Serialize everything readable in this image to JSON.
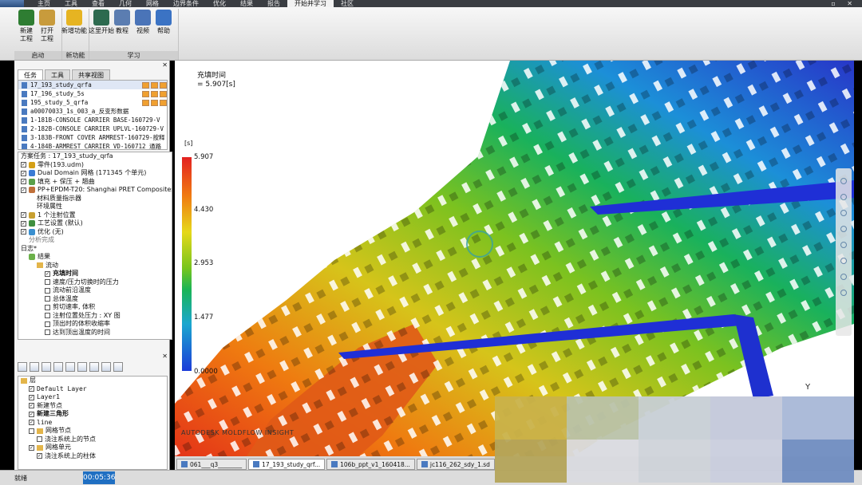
{
  "menubar": {
    "tabs": [
      "主页",
      "工具",
      "查看",
      "几何",
      "网格",
      "边界条件",
      "优化",
      "结果",
      "报告",
      "开始并学习",
      "社区"
    ],
    "active_index": 9
  },
  "ribbon": {
    "groups": [
      {
        "name": "启动",
        "buttons": [
          {
            "label": "新建\n工程",
            "icon": "new-project-icon",
            "color": "#2e7d32"
          },
          {
            "label": "打开\n工程",
            "icon": "open-folder-icon",
            "color": "#c89b3c"
          }
        ]
      },
      {
        "name": "新功能",
        "buttons": [
          {
            "label": "新增功能",
            "icon": "lightbulb-icon",
            "color": "#e6b422"
          }
        ]
      },
      {
        "name": "学习",
        "buttons": [
          {
            "label": "这里开始",
            "icon": "start-here-icon",
            "color": "#2d6a4f"
          },
          {
            "label": "教程",
            "icon": "tutorial-icon",
            "color": "#5b7db1"
          },
          {
            "label": "视频",
            "icon": "video-icon",
            "color": "#4a74b8"
          },
          {
            "label": "帮助",
            "icon": "help-icon",
            "color": "#3b73c4"
          }
        ]
      }
    ]
  },
  "left_panel": {
    "tabs": [
      "任务",
      "工具",
      "共享视图"
    ],
    "study_list": [
      {
        "label": "17_193_study_qrfa",
        "selected": true
      },
      {
        "label": "17_196_study_5s"
      },
      {
        "label": "195_study_5_qrfa"
      },
      {
        "label": "a00070033_1s_003_a_反变形数据"
      },
      {
        "label": "1-181B-CONSOLE CARRIER  BASE-160729-V"
      },
      {
        "label": "2-182B-CONSOLE CARRIER UPLVL-160729-V"
      },
      {
        "label": "3-183B-FRONT COVER ARMREST-160729-按释"
      },
      {
        "label": "4-184B-ARMREST CARRIER VD-160712 通路"
      }
    ],
    "study_tree": [
      {
        "label": "方案任务 : 17_193_study_qrfa",
        "indent": 0,
        "check": ""
      },
      {
        "label": "零件(193.udm)",
        "indent": 0,
        "check": "✓",
        "icon": "#d4a017"
      },
      {
        "label": "Dual Domain 网格 (171345 个单元)",
        "indent": 0,
        "check": "✓",
        "icon": "#3a7bd5"
      },
      {
        "label": "填充 + 保压 + 翘曲",
        "indent": 0,
        "check": "✓",
        "icon": "#5aa04a"
      },
      {
        "label": "PP+EPDM-T20: Shanghai PRET Composites",
        "indent": 0,
        "check": "✓",
        "icon": "#c0703a"
      },
      {
        "label": "材料质量指示器",
        "indent": 2,
        "check": ""
      },
      {
        "label": "环境属性",
        "indent": 2,
        "check": ""
      },
      {
        "label": "1 个注射位置",
        "indent": 0,
        "check": "✓",
        "icon": "#c8a030"
      },
      {
        "label": "工艺设置 (默认)",
        "indent": 0,
        "check": "✓",
        "icon": "#3f8f3f"
      },
      {
        "label": "优化 (无)",
        "indent": 0,
        "check": "✓",
        "icon": "#3a8fcf"
      },
      {
        "label": "分析完成",
        "indent": 1,
        "check": "",
        "dim": true
      },
      {
        "label": "日志*",
        "indent": 0,
        "check": ""
      },
      {
        "label": "结果",
        "indent": 1,
        "check": "",
        "icon": "#6bb04a"
      },
      {
        "label": "流动",
        "indent": 2,
        "check": "",
        "folder": true
      },
      {
        "label": "充填时间",
        "indent": 3,
        "check": "✓",
        "selected": true
      },
      {
        "label": "速度/压力切换时的压力",
        "indent": 3,
        "check": " "
      },
      {
        "label": "流动前沿温度",
        "indent": 3,
        "check": " "
      },
      {
        "label": "总体温度",
        "indent": 3,
        "check": " "
      },
      {
        "label": "剪切速率, 体积",
        "indent": 3,
        "check": " "
      },
      {
        "label": "注射位置处压力 : XY 图",
        "indent": 3,
        "check": " "
      },
      {
        "label": "顶出时的体积收缩率",
        "indent": 3,
        "check": " "
      },
      {
        "label": "达到顶出温度的时间",
        "indent": 3,
        "check": " "
      }
    ],
    "layer_tree": [
      {
        "label": "层",
        "indent": 0,
        "check": "",
        "folder": true
      },
      {
        "label": "Default Layer",
        "indent": 1,
        "check": "✓",
        "mono": true
      },
      {
        "label": "Layer1",
        "indent": 1,
        "check": "✓",
        "mono": true
      },
      {
        "label": "新建节点",
        "indent": 1,
        "check": "✓"
      },
      {
        "label": "新建三角形",
        "indent": 1,
        "check": "✓",
        "bold": true
      },
      {
        "label": "line",
        "indent": 1,
        "check": "✓",
        "mono": true
      },
      {
        "label": "网格节点",
        "indent": 1,
        "check": " ",
        "folder": true
      },
      {
        "label": "浇注系统上的节点",
        "indent": 2,
        "check": " "
      },
      {
        "label": "网格单元",
        "indent": 1,
        "check": "✓",
        "folder": true
      },
      {
        "label": "浇注系统上的柱体",
        "indent": 2,
        "check": "✓"
      }
    ]
  },
  "viewport": {
    "result_title": "充填时间",
    "result_value": "= 5.907[s]",
    "legend_unit": "[s]",
    "legend_ticks": [
      "5.907",
      "4.430",
      "2.953",
      "1.477",
      "0.0000"
    ],
    "brand": "AUTODESK MOLDFLOW INSIGHT",
    "axis_label": "Y"
  },
  "doc_tabs": [
    {
      "label": "061___q3________"
    },
    {
      "label": "17_193_study_qrf..."
    },
    {
      "label": "106b_ppt_v1_160418..."
    },
    {
      "label": "jc116_262_sdy_1.sd"
    }
  ],
  "doc_tabs_active": 1,
  "status": {
    "text": "就绪",
    "timer": "00:05:36"
  }
}
